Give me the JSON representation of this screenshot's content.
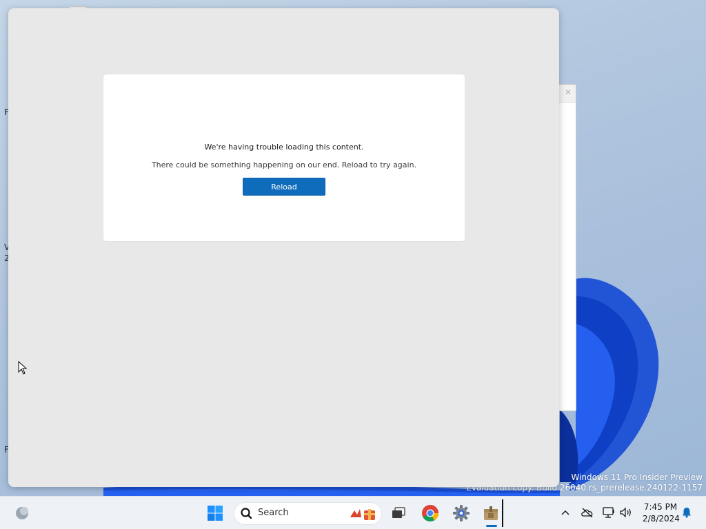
{
  "dialog": {
    "title": "We're having trouble loading this content.",
    "message": "There could be something happening on our end. Reload to try again.",
    "reload_label": "Reload"
  },
  "watermark": {
    "line1": "Windows 11 Pro Insider Preview",
    "line2": "Evaluation copy. Build 26040.rs_prerelease.240122-1157"
  },
  "desktop_edge_labels": [
    "F",
    "V",
    "2",
    "F"
  ],
  "taskbar": {
    "search_label": "Search",
    "apps": [
      "start-icon",
      "search-icon",
      "widgets-gift-icon",
      "task-view-icon",
      "chrome-icon",
      "settings-icon",
      "store-app-icon"
    ],
    "tray": {
      "icons": [
        "chevron-up-icon",
        "onedrive-off-icon",
        "network-icon",
        "volume-icon",
        "notification-bell-icon"
      ],
      "time": "7:45 PM",
      "date": "2/8/2024"
    }
  },
  "colors": {
    "accent": "#0f6cbd",
    "window_bg": "#e8e8e8",
    "card_bg": "#ffffff",
    "taskbar_bg": "#eef2f7"
  }
}
